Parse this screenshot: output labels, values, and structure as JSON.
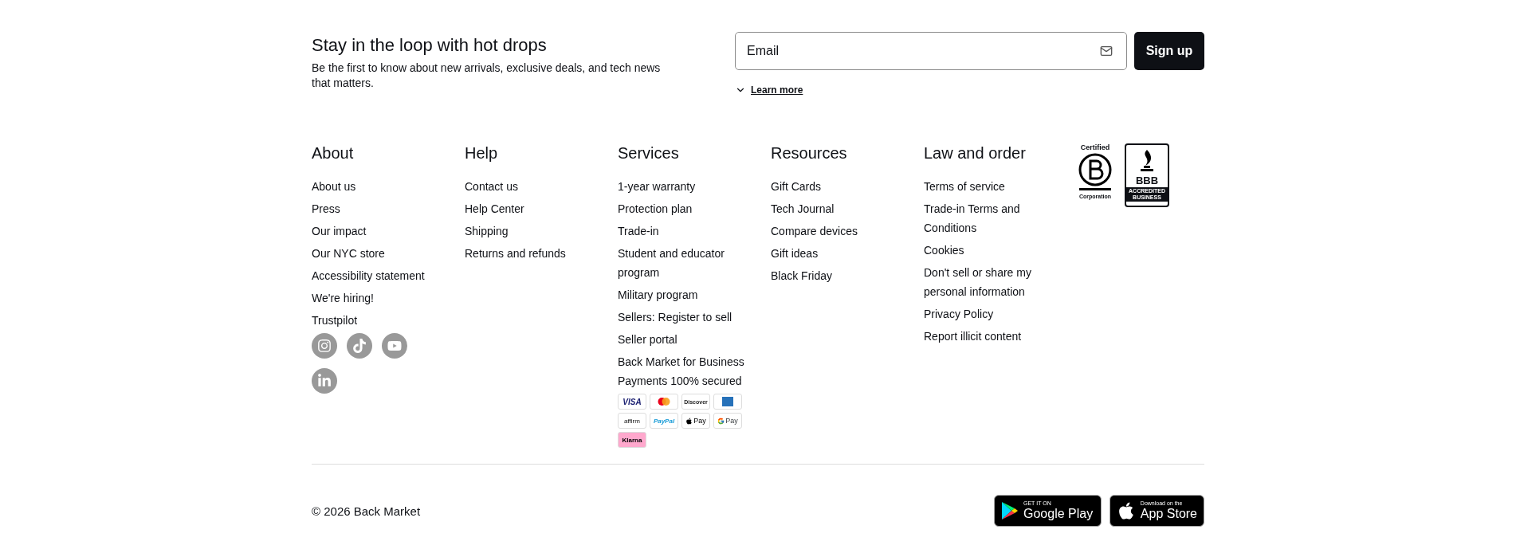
{
  "newsletter": {
    "title": "Stay in the loop with hot drops",
    "text": "Be the first to know about new arrivals, exclusive deals, and tech news that matters.",
    "email": {
      "placeholder": "Email"
    },
    "button": "Sign up",
    "learn_more": "Learn more"
  },
  "columns": [
    {
      "title": "About",
      "links": [
        "About us",
        "Press",
        "Our impact",
        "Our NYC store",
        "Accessibility statement",
        "We're hiring!",
        "Trustpilot"
      ],
      "social": [
        {
          "kind": "instagram"
        },
        {
          "kind": "tiktok"
        },
        {
          "kind": "youtube"
        },
        {
          "kind": "linkedin"
        }
      ]
    },
    {
      "title": "Help",
      "links": [
        "Contact us",
        "Help Center",
        "Shipping",
        "Returns and refunds"
      ]
    },
    {
      "title": "Services",
      "links": [
        "1-year warranty",
        "Protection plan",
        "Trade-in",
        "Student and educator program",
        "Military program",
        "Sellers: Register to sell",
        "Seller portal",
        "Back Market for Business"
      ],
      "payments_title": "Payments 100% secured",
      "payments": [
        {
          "kind": "visa",
          "label": "VISA"
        },
        {
          "kind": "mastercard"
        },
        {
          "kind": "discover",
          "label": "Discover"
        },
        {
          "kind": "amex"
        },
        {
          "kind": "affirm",
          "label": "affirm"
        },
        {
          "kind": "paypal",
          "label": "PayPal"
        },
        {
          "kind": "apple",
          "label": "Pay"
        },
        {
          "kind": "google",
          "label": "Pay"
        },
        {
          "kind": "klarna",
          "label": "Klarna"
        }
      ]
    },
    {
      "title": "Resources",
      "links": [
        "Gift Cards",
        "Tech Journal",
        "Compare devices",
        "Gift ideas",
        "Black Friday"
      ]
    },
    {
      "title": "Law and order",
      "links": [
        "Terms of service",
        "Trade-in Terms and Conditions",
        "Cookies",
        "Don't sell or share my personal information",
        "Privacy Policy",
        "Report illicit content"
      ]
    }
  ],
  "certifications": {
    "bcorp": {
      "top": "Certified",
      "bottom": "Corporation"
    },
    "bbb": {
      "top": "BBB",
      "bottom": "ACCREDITED BUSINESS"
    }
  },
  "copyright": "© 2026 Back Market",
  "stores": [
    {
      "kind": "google",
      "small": "GET IT ON",
      "big": "Google Play"
    },
    {
      "kind": "apple",
      "small": "Download on the",
      "big": "App Store"
    }
  ]
}
